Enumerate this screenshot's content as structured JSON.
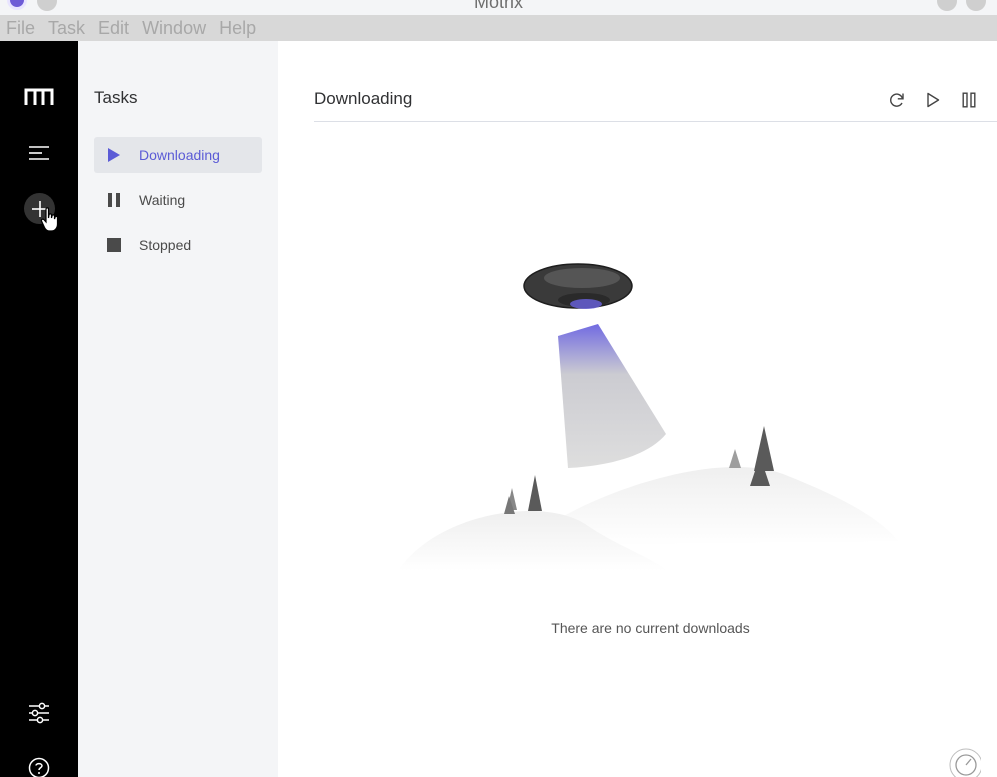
{
  "window": {
    "title": "Motrix"
  },
  "menu": [
    "File",
    "Task",
    "Edit",
    "Window",
    "Help"
  ],
  "rail": {
    "icons": [
      "motrix-logo-icon",
      "menu-lines-icon",
      "add-icon",
      "settings-sliders-icon",
      "help-circle-icon"
    ]
  },
  "sidebar": {
    "title": "Tasks",
    "items": [
      {
        "label": "Downloading",
        "icon": "play-icon",
        "active": true
      },
      {
        "label": "Waiting",
        "icon": "pause-icon",
        "active": false
      },
      {
        "label": "Stopped",
        "icon": "stop-icon",
        "active": false
      }
    ]
  },
  "main": {
    "title": "Downloading",
    "toolbar": [
      "refresh-icon",
      "resume-all-icon",
      "pause-all-icon"
    ],
    "empty_message": "There are no current downloads"
  },
  "colors": {
    "accent": "#5b5bd6",
    "rail": "#000000",
    "sidebar": "#f4f5f7"
  }
}
